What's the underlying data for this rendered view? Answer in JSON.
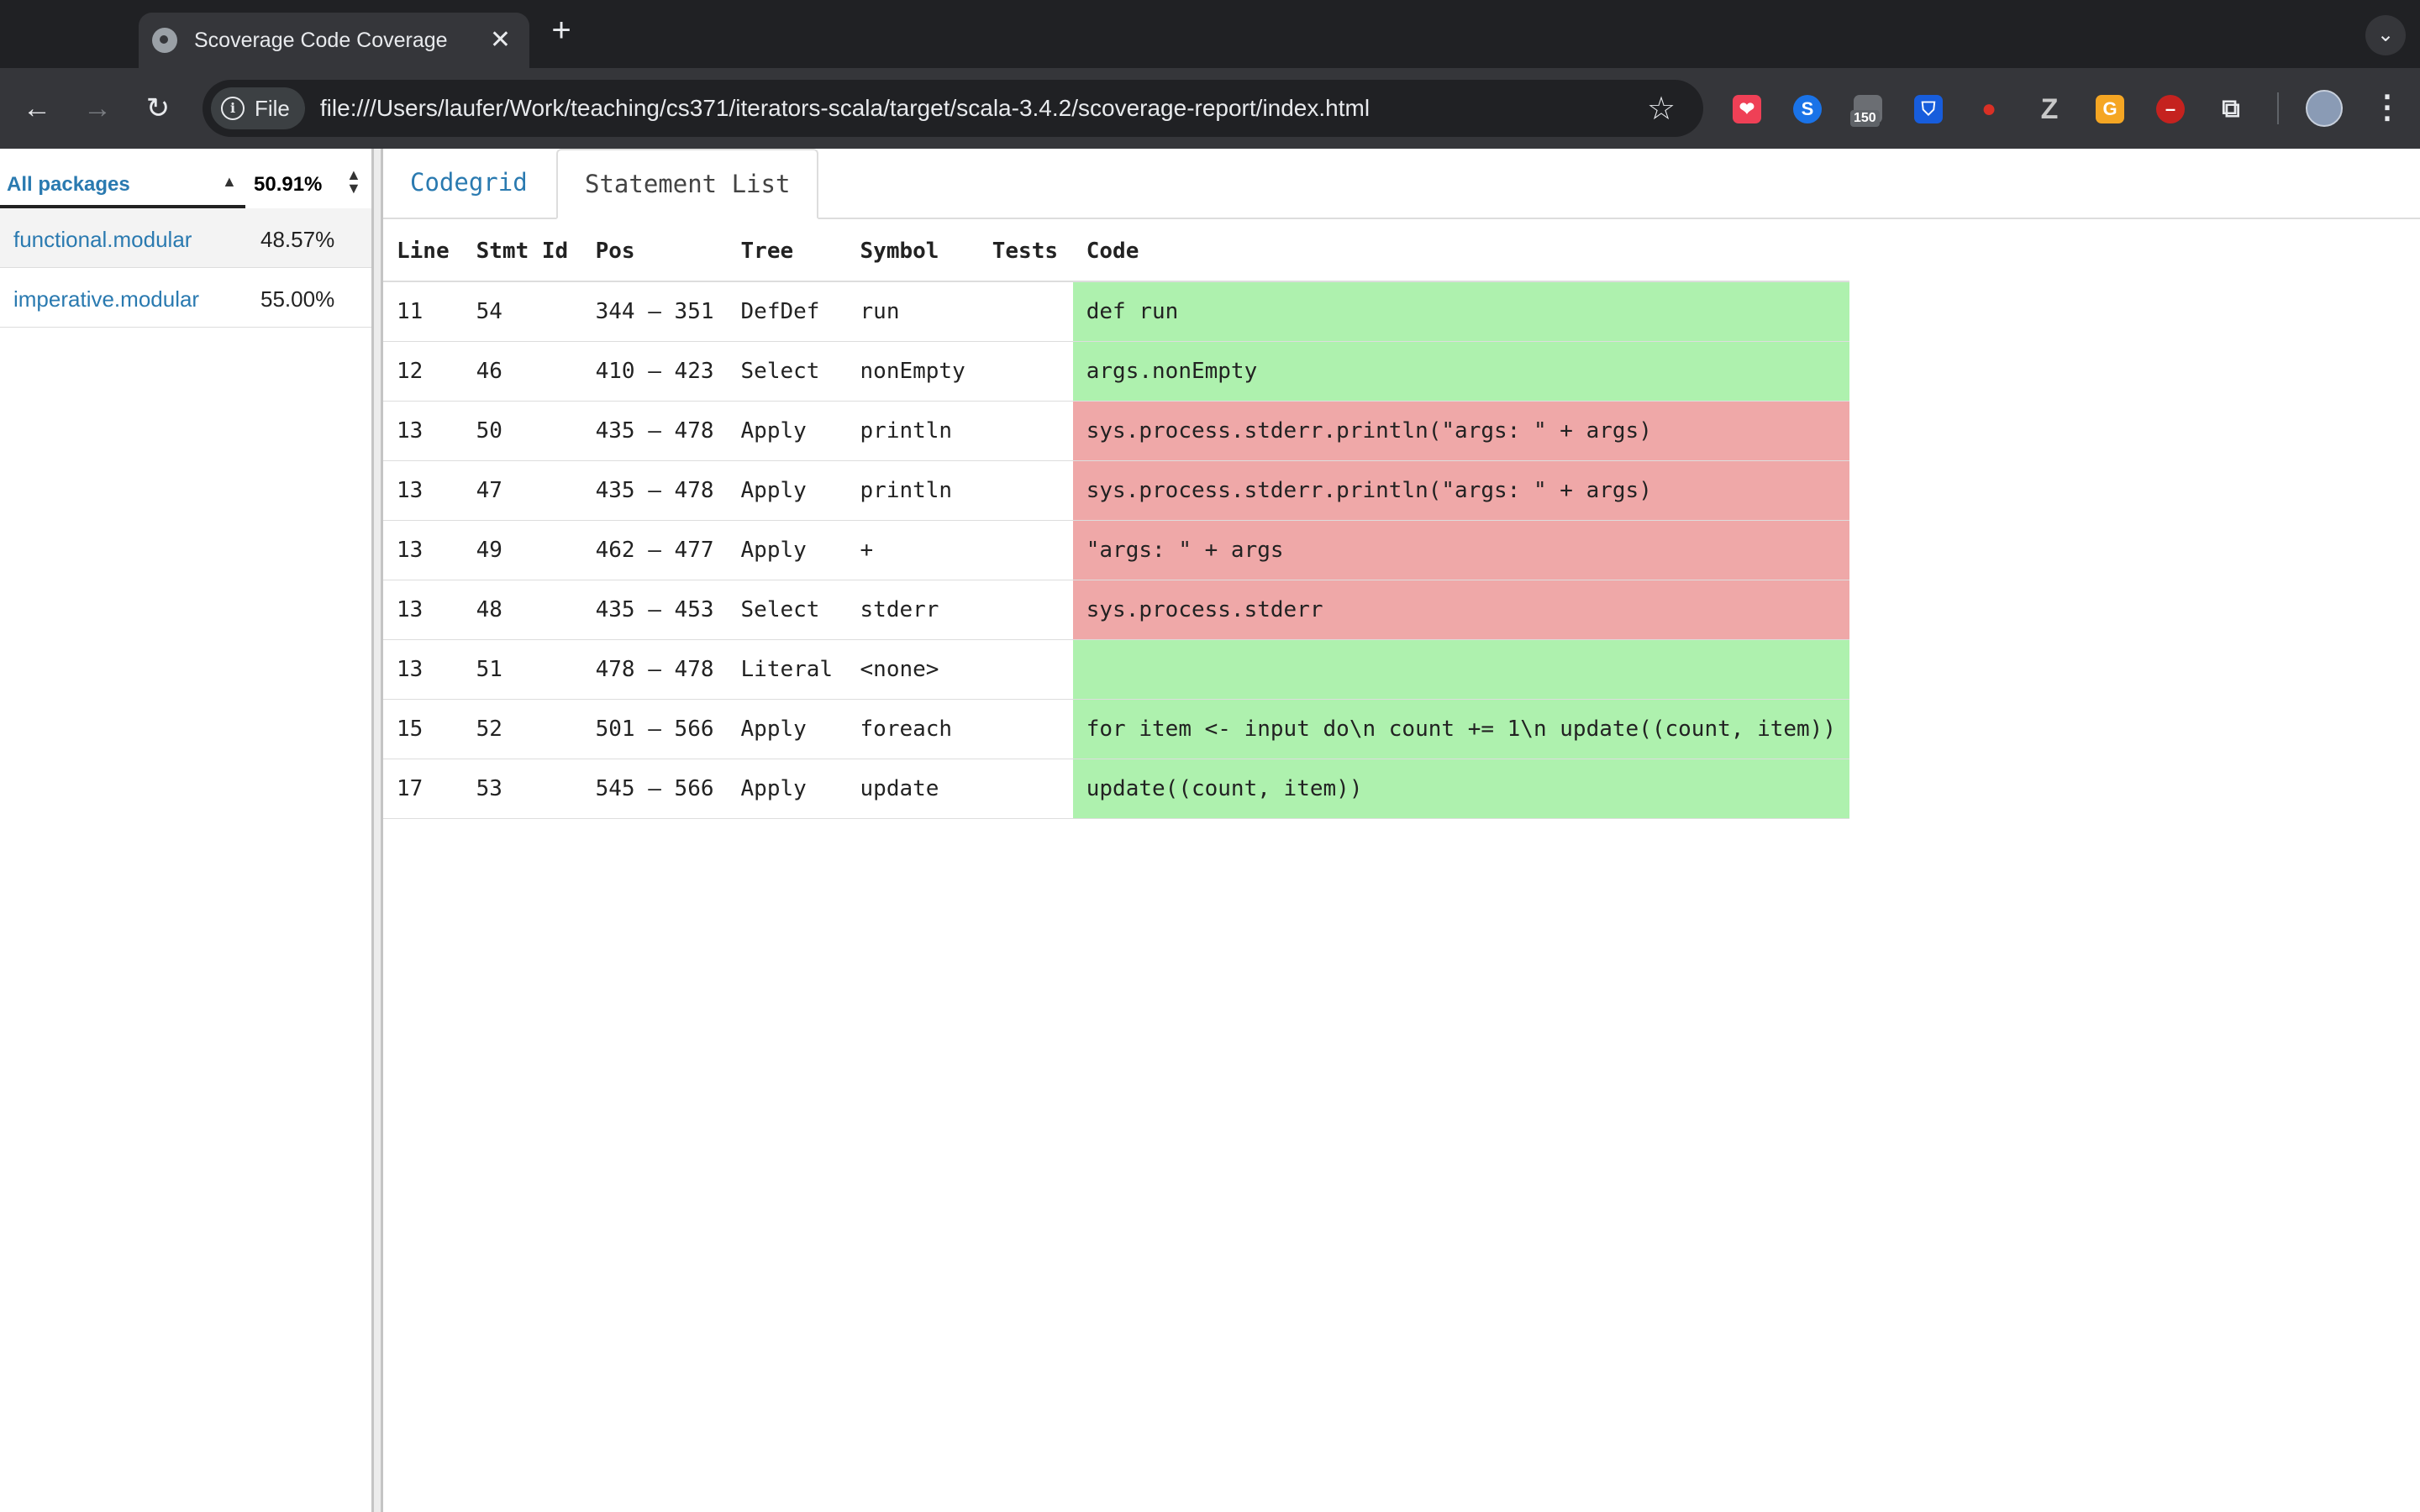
{
  "browser": {
    "tab_title": "Scoverage Code Coverage",
    "tab_close": "✕",
    "new_tab": "+",
    "tab_search": "⌄",
    "chip_label": "File",
    "url": "file:///Users/laufer/Work/teaching/cs371/iterators-scala/target/scala-3.4.2/scoverage-report/index.html",
    "ext_badge": "150"
  },
  "sidebar": {
    "header_label": "All packages",
    "header_total": "50.91%",
    "packages": [
      {
        "name": "functional.modular",
        "pct": "48.57%"
      },
      {
        "name": "imperative.modular",
        "pct": "55.00%"
      }
    ]
  },
  "tabs": {
    "codegrid": "Codegrid",
    "statement_list": "Statement List"
  },
  "table": {
    "headers": {
      "line": "Line",
      "stmt_id": "Stmt Id",
      "pos": "Pos",
      "tree": "Tree",
      "symbol": "Symbol",
      "tests": "Tests",
      "code": "Code"
    },
    "rows": [
      {
        "line": "11",
        "stmt_id": "54",
        "pos": "344 – 351",
        "tree": "DefDef",
        "symbol": "run",
        "tests": "",
        "code": "def run",
        "covered": true
      },
      {
        "line": "12",
        "stmt_id": "46",
        "pos": "410 – 423",
        "tree": "Select",
        "symbol": "nonEmpty",
        "tests": "",
        "code": "args.nonEmpty",
        "covered": true
      },
      {
        "line": "13",
        "stmt_id": "50",
        "pos": "435 – 478",
        "tree": "Apply",
        "symbol": "println",
        "tests": "",
        "code": "sys.process.stderr.println(\"args: \" + args)",
        "covered": false
      },
      {
        "line": "13",
        "stmt_id": "47",
        "pos": "435 – 478",
        "tree": "Apply",
        "symbol": "println",
        "tests": "",
        "code": "sys.process.stderr.println(\"args: \" + args)",
        "covered": false
      },
      {
        "line": "13",
        "stmt_id": "49",
        "pos": "462 – 477",
        "tree": "Apply",
        "symbol": "+",
        "tests": "",
        "code": "\"args: \" + args",
        "covered": false
      },
      {
        "line": "13",
        "stmt_id": "48",
        "pos": "435 – 453",
        "tree": "Select",
        "symbol": "stderr",
        "tests": "",
        "code": "sys.process.stderr",
        "covered": false
      },
      {
        "line": "13",
        "stmt_id": "51",
        "pos": "478 – 478",
        "tree": "Literal",
        "symbol": "<none>",
        "tests": "",
        "code": "",
        "covered": true
      },
      {
        "line": "15",
        "stmt_id": "52",
        "pos": "501 – 566",
        "tree": "Apply",
        "symbol": "foreach",
        "tests": "",
        "code": "for item <- input do\\n count += 1\\n update((count, item))",
        "covered": true
      },
      {
        "line": "17",
        "stmt_id": "53",
        "pos": "545 – 566",
        "tree": "Apply",
        "symbol": "update",
        "tests": "",
        "code": "update((count, item))",
        "covered": true
      }
    ]
  },
  "colors": {
    "covered": "#aef1ae",
    "uncovered": "#efa8a8",
    "link": "#2a7ab0"
  }
}
